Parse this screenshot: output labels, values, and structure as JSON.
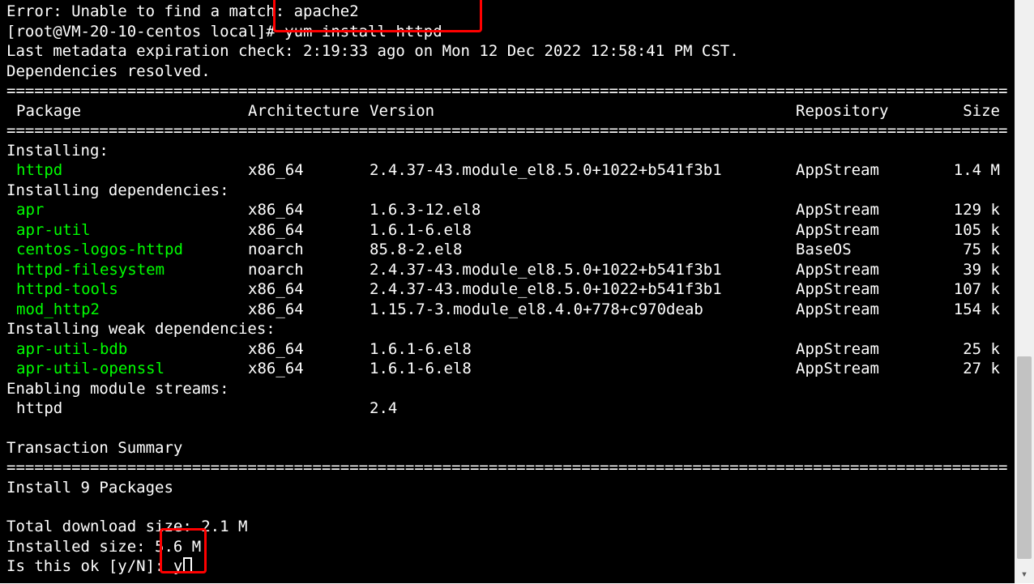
{
  "preamble": {
    "error_line": "Error: Unable to find a match: apache2",
    "prompt": "[root@VM-20-10-centos local]# ",
    "command": "yum install httpd",
    "meta_line": "Last metadata expiration check: 2:19:33 ago on Mon 12 Dec 2022 12:58:41 PM CST.",
    "deps_resolved": "Dependencies resolved."
  },
  "headers": {
    "package": "Package",
    "arch": "Architecture",
    "version": "Version",
    "repo": "Repository",
    "size": "Size"
  },
  "sections": {
    "installing": "Installing:",
    "installing_deps": "Installing dependencies:",
    "installing_weak": "Installing weak dependencies:",
    "enabling_streams": "Enabling module streams:",
    "transaction_summary": "Transaction Summary",
    "install_count": "Install  9 Packages",
    "total_dl": "Total download size: 2.1 M",
    "installed_size": "Installed size: 5.6 M",
    "confirm_prompt": "Is this ok [y/N]: ",
    "confirm_answer": "y"
  },
  "packages": {
    "main": [
      {
        "name": "httpd",
        "arch": "x86_64",
        "version": "2.4.37-43.module_el8.5.0+1022+b541f3b1",
        "repo": "AppStream",
        "size": "1.4 M"
      }
    ],
    "deps": [
      {
        "name": "apr",
        "arch": "x86_64",
        "version": "1.6.3-12.el8",
        "repo": "AppStream",
        "size": "129 k"
      },
      {
        "name": "apr-util",
        "arch": "x86_64",
        "version": "1.6.1-6.el8",
        "repo": "AppStream",
        "size": "105 k"
      },
      {
        "name": "centos-logos-httpd",
        "arch": "noarch",
        "version": "85.8-2.el8",
        "repo": "BaseOS",
        "size": "75 k"
      },
      {
        "name": "httpd-filesystem",
        "arch": "noarch",
        "version": "2.4.37-43.module_el8.5.0+1022+b541f3b1",
        "repo": "AppStream",
        "size": "39 k"
      },
      {
        "name": "httpd-tools",
        "arch": "x86_64",
        "version": "2.4.37-43.module_el8.5.0+1022+b541f3b1",
        "repo": "AppStream",
        "size": "107 k"
      },
      {
        "name": "mod_http2",
        "arch": "x86_64",
        "version": "1.15.7-3.module_el8.4.0+778+c970deab",
        "repo": "AppStream",
        "size": "154 k"
      }
    ],
    "weak": [
      {
        "name": "apr-util-bdb",
        "arch": "x86_64",
        "version": "1.6.1-6.el8",
        "repo": "AppStream",
        "size": "25 k"
      },
      {
        "name": "apr-util-openssl",
        "arch": "x86_64",
        "version": "1.6.1-6.el8",
        "repo": "AppStream",
        "size": "27 k"
      }
    ],
    "streams": [
      {
        "name": "httpd",
        "arch": "",
        "version": "2.4",
        "repo": "",
        "size": ""
      }
    ]
  },
  "divider": "==================================================================================================================================="
}
